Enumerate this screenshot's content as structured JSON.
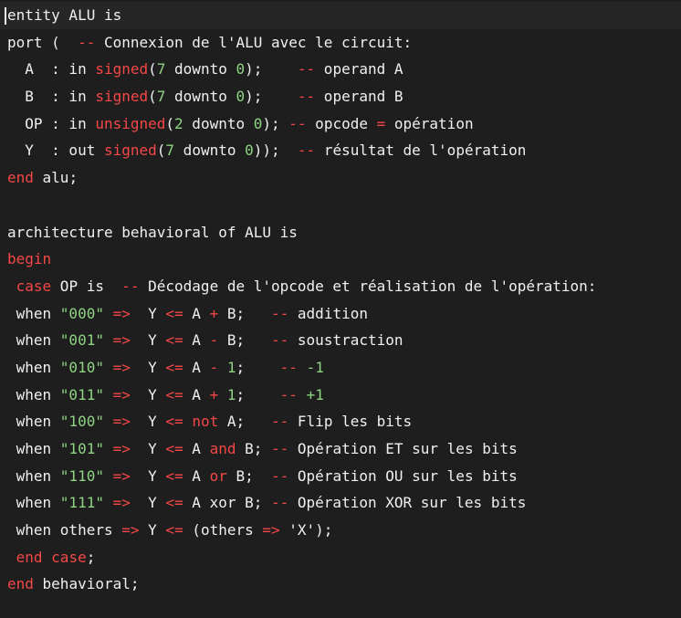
{
  "colors": {
    "background": "#1e1e1e",
    "text": "#f0f0f0",
    "keyword_red": "#f44747",
    "number_green": "#8fd383",
    "comment_green": "#7fc87f"
  },
  "code_lines": [
    [
      {
        "t": "entity ALU is",
        "c": "t-kw"
      }
    ],
    [
      {
        "t": "port (  ",
        "c": "t-kw"
      },
      {
        "t": "--",
        "c": "t-red"
      },
      {
        "t": " Connexion de l'ALU avec le circuit:",
        "c": "t-com"
      }
    ],
    [
      {
        "t": "  A  : in ",
        "c": "t-kw"
      },
      {
        "t": "signed",
        "c": "t-red"
      },
      {
        "t": "(",
        "c": "t-kw"
      },
      {
        "t": "7",
        "c": "t-num"
      },
      {
        "t": " downto ",
        "c": "t-kw"
      },
      {
        "t": "0",
        "c": "t-num"
      },
      {
        "t": ");    ",
        "c": "t-kw"
      },
      {
        "t": "--",
        "c": "t-red"
      },
      {
        "t": " operand A",
        "c": "t-com"
      }
    ],
    [
      {
        "t": "  B  : in ",
        "c": "t-kw"
      },
      {
        "t": "signed",
        "c": "t-red"
      },
      {
        "t": "(",
        "c": "t-kw"
      },
      {
        "t": "7",
        "c": "t-num"
      },
      {
        "t": " downto ",
        "c": "t-kw"
      },
      {
        "t": "0",
        "c": "t-num"
      },
      {
        "t": ");    ",
        "c": "t-kw"
      },
      {
        "t": "--",
        "c": "t-red"
      },
      {
        "t": " operand B",
        "c": "t-com"
      }
    ],
    [
      {
        "t": "  OP : in ",
        "c": "t-kw"
      },
      {
        "t": "unsigned",
        "c": "t-red"
      },
      {
        "t": "(",
        "c": "t-kw"
      },
      {
        "t": "2",
        "c": "t-num"
      },
      {
        "t": " downto ",
        "c": "t-kw"
      },
      {
        "t": "0",
        "c": "t-num"
      },
      {
        "t": "); ",
        "c": "t-kw"
      },
      {
        "t": "--",
        "c": "t-red"
      },
      {
        "t": " opcode ",
        "c": "t-com"
      },
      {
        "t": "=",
        "c": "t-red"
      },
      {
        "t": " opération",
        "c": "t-com"
      }
    ],
    [
      {
        "t": "  Y  : out ",
        "c": "t-kw"
      },
      {
        "t": "signed",
        "c": "t-red"
      },
      {
        "t": "(",
        "c": "t-kw"
      },
      {
        "t": "7",
        "c": "t-num"
      },
      {
        "t": " downto ",
        "c": "t-kw"
      },
      {
        "t": "0",
        "c": "t-num"
      },
      {
        "t": "));  ",
        "c": "t-kw"
      },
      {
        "t": "--",
        "c": "t-red"
      },
      {
        "t": " résultat de l'opération",
        "c": "t-com"
      }
    ],
    [
      {
        "t": "end",
        "c": "t-red"
      },
      {
        "t": " alu;",
        "c": "t-kw"
      }
    ],
    [],
    [
      {
        "t": "architecture behavioral of ALU is",
        "c": "t-kw"
      }
    ],
    [
      {
        "t": "begin",
        "c": "t-red"
      }
    ],
    [
      {
        "t": " ",
        "c": "t-kw"
      },
      {
        "t": "case",
        "c": "t-red"
      },
      {
        "t": " OP is  ",
        "c": "t-kw"
      },
      {
        "t": "--",
        "c": "t-red"
      },
      {
        "t": " Décodage de l'opcode et réalisation de l'opération:",
        "c": "t-com"
      }
    ],
    [
      {
        "t": " when ",
        "c": "t-kw"
      },
      {
        "t": "\"000\"",
        "c": "t-str"
      },
      {
        "t": " ",
        "c": "t-kw"
      },
      {
        "t": "=>",
        "c": "t-red"
      },
      {
        "t": "  Y ",
        "c": "t-kw"
      },
      {
        "t": "<=",
        "c": "t-red"
      },
      {
        "t": " A ",
        "c": "t-kw"
      },
      {
        "t": "+",
        "c": "t-red"
      },
      {
        "t": " B;   ",
        "c": "t-kw"
      },
      {
        "t": "--",
        "c": "t-red"
      },
      {
        "t": " addition",
        "c": "t-com"
      }
    ],
    [
      {
        "t": " when ",
        "c": "t-kw"
      },
      {
        "t": "\"001\"",
        "c": "t-str"
      },
      {
        "t": " ",
        "c": "t-kw"
      },
      {
        "t": "=>",
        "c": "t-red"
      },
      {
        "t": "  Y ",
        "c": "t-kw"
      },
      {
        "t": "<=",
        "c": "t-red"
      },
      {
        "t": " A ",
        "c": "t-kw"
      },
      {
        "t": "-",
        "c": "t-red"
      },
      {
        "t": " B;   ",
        "c": "t-kw"
      },
      {
        "t": "--",
        "c": "t-red"
      },
      {
        "t": " soustraction",
        "c": "t-com"
      }
    ],
    [
      {
        "t": " when ",
        "c": "t-kw"
      },
      {
        "t": "\"010\"",
        "c": "t-str"
      },
      {
        "t": " ",
        "c": "t-kw"
      },
      {
        "t": "=>",
        "c": "t-red"
      },
      {
        "t": "  Y ",
        "c": "t-kw"
      },
      {
        "t": "<=",
        "c": "t-red"
      },
      {
        "t": " A ",
        "c": "t-kw"
      },
      {
        "t": "-",
        "c": "t-red"
      },
      {
        "t": " ",
        "c": "t-kw"
      },
      {
        "t": "1",
        "c": "t-num"
      },
      {
        "t": ";    ",
        "c": "t-kw"
      },
      {
        "t": "--",
        "c": "t-red"
      },
      {
        "t": " ",
        "c": "t-com"
      },
      {
        "t": "-1",
        "c": "t-num"
      }
    ],
    [
      {
        "t": " when ",
        "c": "t-kw"
      },
      {
        "t": "\"011\"",
        "c": "t-str"
      },
      {
        "t": " ",
        "c": "t-kw"
      },
      {
        "t": "=>",
        "c": "t-red"
      },
      {
        "t": "  Y ",
        "c": "t-kw"
      },
      {
        "t": "<=",
        "c": "t-red"
      },
      {
        "t": " A ",
        "c": "t-kw"
      },
      {
        "t": "+",
        "c": "t-red"
      },
      {
        "t": " ",
        "c": "t-kw"
      },
      {
        "t": "1",
        "c": "t-num"
      },
      {
        "t": ";    ",
        "c": "t-kw"
      },
      {
        "t": "--",
        "c": "t-red"
      },
      {
        "t": " ",
        "c": "t-com"
      },
      {
        "t": "+1",
        "c": "t-num"
      }
    ],
    [
      {
        "t": " when ",
        "c": "t-kw"
      },
      {
        "t": "\"100\"",
        "c": "t-str"
      },
      {
        "t": " ",
        "c": "t-kw"
      },
      {
        "t": "=>",
        "c": "t-red"
      },
      {
        "t": "  Y ",
        "c": "t-kw"
      },
      {
        "t": "<=",
        "c": "t-red"
      },
      {
        "t": " ",
        "c": "t-kw"
      },
      {
        "t": "not",
        "c": "t-red"
      },
      {
        "t": " A;   ",
        "c": "t-kw"
      },
      {
        "t": "--",
        "c": "t-red"
      },
      {
        "t": " Flip les bits",
        "c": "t-com"
      }
    ],
    [
      {
        "t": " when ",
        "c": "t-kw"
      },
      {
        "t": "\"101\"",
        "c": "t-str"
      },
      {
        "t": " ",
        "c": "t-kw"
      },
      {
        "t": "=>",
        "c": "t-red"
      },
      {
        "t": "  Y ",
        "c": "t-kw"
      },
      {
        "t": "<=",
        "c": "t-red"
      },
      {
        "t": " A ",
        "c": "t-kw"
      },
      {
        "t": "and",
        "c": "t-red"
      },
      {
        "t": " B; ",
        "c": "t-kw"
      },
      {
        "t": "--",
        "c": "t-red"
      },
      {
        "t": " Opération ET sur les bits",
        "c": "t-com"
      }
    ],
    [
      {
        "t": " when ",
        "c": "t-kw"
      },
      {
        "t": "\"110\"",
        "c": "t-str"
      },
      {
        "t": " ",
        "c": "t-kw"
      },
      {
        "t": "=>",
        "c": "t-red"
      },
      {
        "t": "  Y ",
        "c": "t-kw"
      },
      {
        "t": "<=",
        "c": "t-red"
      },
      {
        "t": " A ",
        "c": "t-kw"
      },
      {
        "t": "or",
        "c": "t-red"
      },
      {
        "t": " B;  ",
        "c": "t-kw"
      },
      {
        "t": "--",
        "c": "t-red"
      },
      {
        "t": " Opération OU sur les bits",
        "c": "t-com"
      }
    ],
    [
      {
        "t": " when ",
        "c": "t-kw"
      },
      {
        "t": "\"111\"",
        "c": "t-str"
      },
      {
        "t": " ",
        "c": "t-kw"
      },
      {
        "t": "=>",
        "c": "t-red"
      },
      {
        "t": "  Y ",
        "c": "t-kw"
      },
      {
        "t": "<=",
        "c": "t-red"
      },
      {
        "t": " A xor B; ",
        "c": "t-kw"
      },
      {
        "t": "--",
        "c": "t-red"
      },
      {
        "t": " Opération XOR sur les bits",
        "c": "t-com"
      }
    ],
    [
      {
        "t": " when others ",
        "c": "t-kw"
      },
      {
        "t": "=>",
        "c": "t-red"
      },
      {
        "t": " Y ",
        "c": "t-kw"
      },
      {
        "t": "<=",
        "c": "t-red"
      },
      {
        "t": " (others ",
        "c": "t-kw"
      },
      {
        "t": "=>",
        "c": "t-red"
      },
      {
        "t": " 'X');",
        "c": "t-kw"
      }
    ],
    [
      {
        "t": " ",
        "c": "t-kw"
      },
      {
        "t": "end case",
        "c": "t-red"
      },
      {
        "t": ";",
        "c": "t-kw"
      }
    ],
    [
      {
        "t": "end",
        "c": "t-red"
      },
      {
        "t": " behavioral;",
        "c": "t-kw"
      }
    ]
  ]
}
